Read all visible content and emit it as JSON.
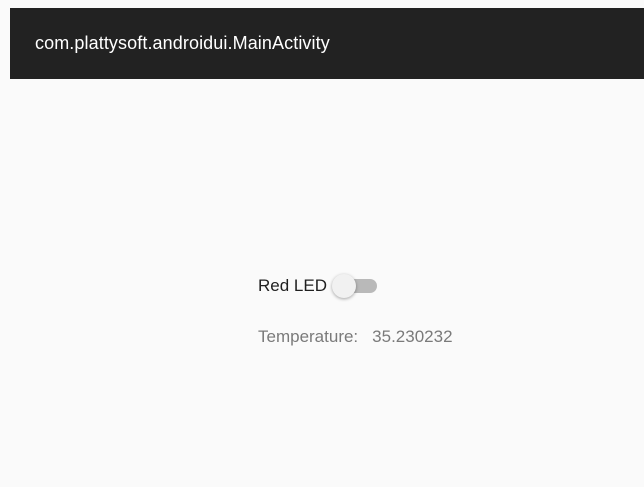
{
  "app_bar": {
    "title": "com.plattysoft.androidui.MainActivity"
  },
  "controls": {
    "red_led": {
      "label": "Red LED",
      "checked": false
    },
    "temperature": {
      "label": "Temperature:",
      "value": "35.230232"
    }
  },
  "colors": {
    "app_bar_background": "#222222",
    "screen_background": "#fafafa",
    "label_text": "#1f1f1f",
    "secondary_text": "#7a7a7a",
    "switch_track_off": "#b9b9b9",
    "switch_thumb_off": "#f1f1f1"
  }
}
